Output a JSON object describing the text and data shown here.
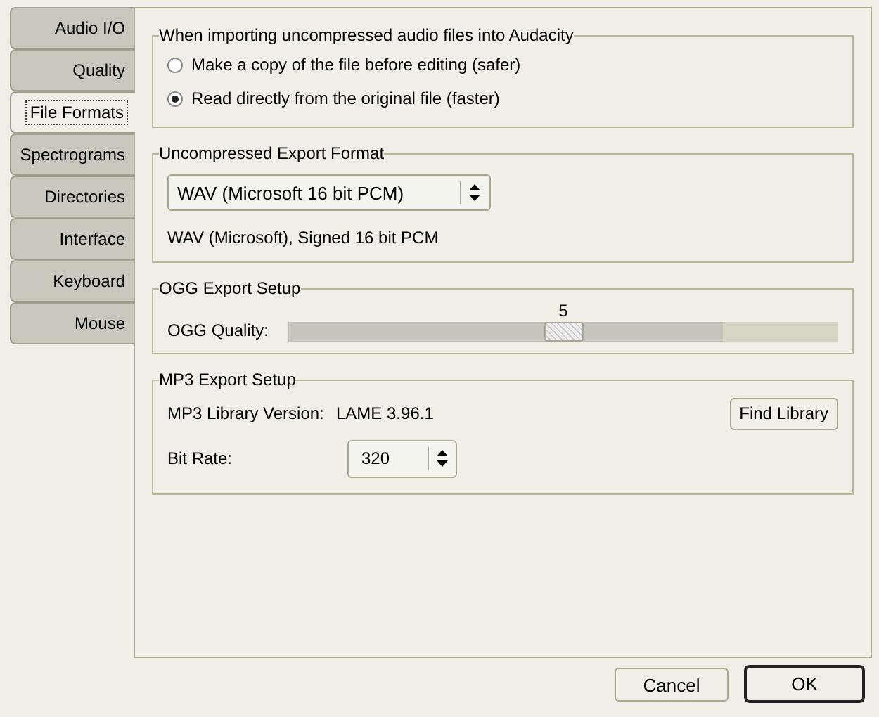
{
  "tabs": [
    {
      "label": "Audio I/O",
      "selected": false
    },
    {
      "label": "Quality",
      "selected": false
    },
    {
      "label": "File Formats",
      "selected": true
    },
    {
      "label": "Spectrograms",
      "selected": false
    },
    {
      "label": "Directories",
      "selected": false
    },
    {
      "label": "Interface",
      "selected": false
    },
    {
      "label": "Keyboard",
      "selected": false
    },
    {
      "label": "Mouse",
      "selected": false
    }
  ],
  "import_group": {
    "title": "When importing uncompressed audio files into Audacity",
    "options": [
      {
        "label": "Make a copy of the file before editing (safer)",
        "selected": false
      },
      {
        "label": "Read directly from the original file (faster)",
        "selected": true
      }
    ]
  },
  "export_format": {
    "title": "Uncompressed Export Format",
    "dropdown": "WAV (Microsoft 16 bit PCM)",
    "description": "WAV (Microsoft), Signed 16 bit PCM"
  },
  "ogg": {
    "title": "OGG Export Setup",
    "label": "OGG Quality:",
    "reading": "5",
    "level": 0.5
  },
  "mp3": {
    "title": "MP3 Export Setup",
    "version_label": "MP3 Library Version:",
    "version": "LAME 3.96.1",
    "find_button": "Find Library",
    "bitrate_label": "Bit Rate:",
    "bitrate": "320"
  },
  "buttons": [
    {
      "label": "Cancel",
      "kind": "normal"
    },
    {
      "label": "OK",
      "kind": "default"
    }
  ]
}
